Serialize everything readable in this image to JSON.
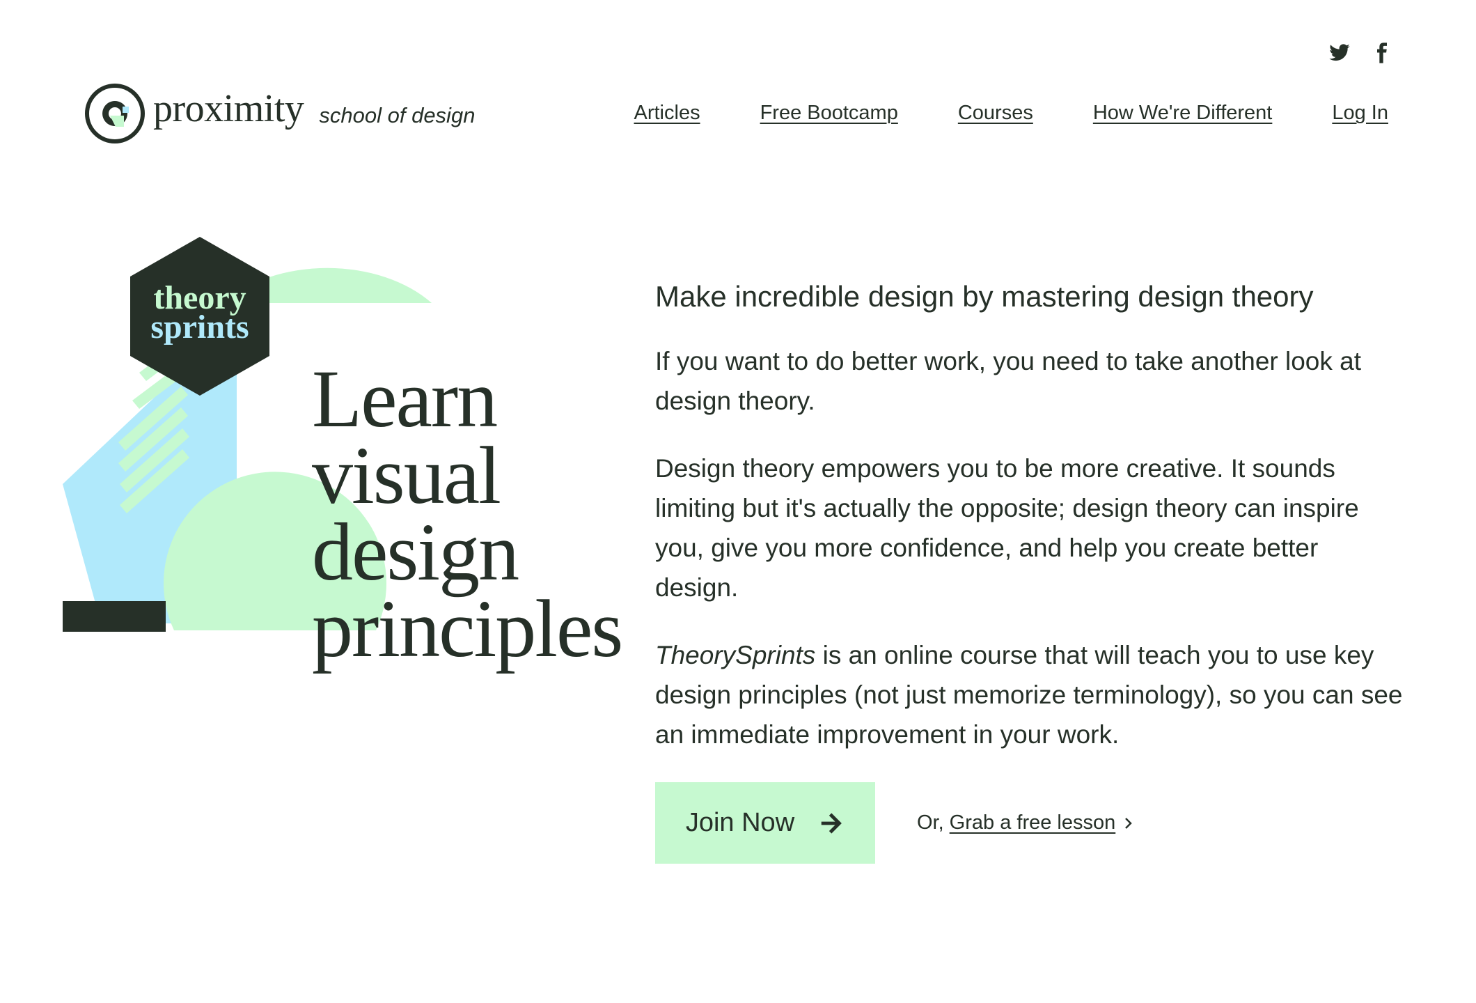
{
  "social": {
    "twitter_icon": "twitter-icon",
    "facebook_icon": "facebook-icon"
  },
  "header": {
    "brand": "proximity",
    "tagline": "school of design",
    "nav": [
      {
        "label": "Articles"
      },
      {
        "label": "Free Bootcamp"
      },
      {
        "label": "Courses"
      },
      {
        "label": "How We're Different"
      },
      {
        "label": "Log In"
      }
    ]
  },
  "hero": {
    "badge_line1": "theory",
    "badge_line2": "sprints",
    "title_lines": [
      "Learn",
      "visual",
      "design",
      "principles"
    ]
  },
  "content": {
    "lead": "Make incredible design by mastering design theory",
    "para1": "If you want to do better work, you need to take another look at design theory.",
    "para2": "Design theory empowers you to be more creative. It sounds limiting but it's actually the opposite; design theory can inspire you, give you more confidence, and help you create better design.",
    "para3_italic": "TheorySprints",
    "para3_rest": " is an online course that will teach you to use key design principles (not just memorize terminology), so you can see an immediate improvement in your work.",
    "join_label": "Join Now",
    "or_label": "Or,",
    "free_lesson_label": "Grab a free lesson"
  },
  "colors": {
    "dark": "#263028",
    "mint": "#c6f9d0",
    "sky": "#b0e9fb",
    "background": "#ffffff"
  }
}
